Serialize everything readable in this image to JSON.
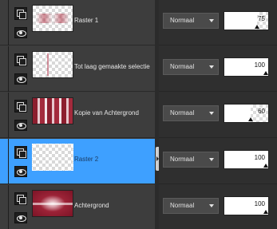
{
  "layers": [
    {
      "name": "Raster 1",
      "blend_mode": "Normaal",
      "opacity": "75",
      "opacity_fraction": 0.75,
      "selected": false
    },
    {
      "name": "Tot laag gemaakte selectie",
      "blend_mode": "Normaal",
      "opacity": "100",
      "opacity_fraction": 1.0,
      "selected": false
    },
    {
      "name": "Kopie van Achtergrond",
      "blend_mode": "Normaal",
      "opacity": "60",
      "opacity_fraction": 0.6,
      "selected": false
    },
    {
      "name": "Raster 2",
      "blend_mode": "Normaal",
      "opacity": "100",
      "opacity_fraction": 1.0,
      "selected": true
    },
    {
      "name": "Achtergrond",
      "blend_mode": "Normaal",
      "opacity": "100",
      "opacity_fraction": 1.0,
      "selected": false
    }
  ],
  "colors": {
    "selection": "#3ea0ff",
    "panel_bg": "#3c3c3c",
    "thumb_red": "#9c2337"
  },
  "icons": {
    "layer_type": "raster-layer-icon",
    "visibility": "eye-icon",
    "dropdown": "chevron-down-icon"
  }
}
